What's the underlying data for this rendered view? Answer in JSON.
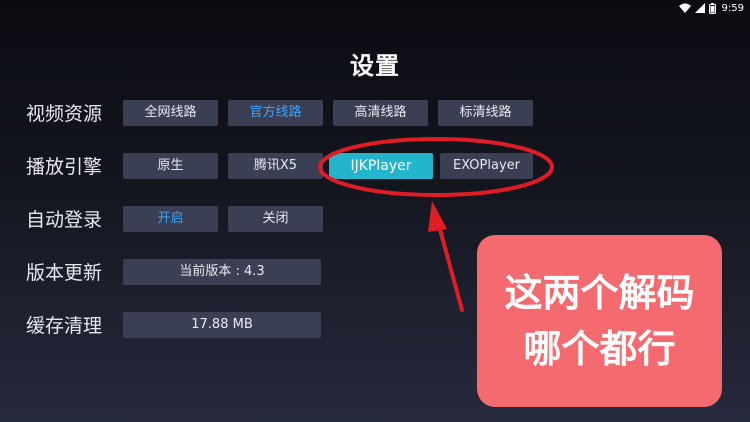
{
  "status_bar": {
    "time": "9:59",
    "icons": [
      "wifi-icon",
      "signal-icon",
      "battery-icon"
    ]
  },
  "title": "设置",
  "settings": {
    "video_source": {
      "label": "视频资源",
      "options": [
        "全网线路",
        "官方线路",
        "高清线路",
        "标清线路"
      ],
      "selected": "官方线路"
    },
    "player_engine": {
      "label": "播放引擎",
      "options": [
        "原生",
        "腾讯X5",
        "IJKPlayer",
        "EXOPlayer"
      ],
      "selected": "IJKPlayer"
    },
    "auto_login": {
      "label": "自动登录",
      "options": [
        "开启",
        "关闭"
      ],
      "selected": "开启"
    },
    "version": {
      "label": "版本更新",
      "value": "当前版本 : 4.3"
    },
    "cache": {
      "label": "缓存清理",
      "value": "17.88 MB"
    }
  },
  "annotation": {
    "line1": "这两个解码",
    "line2": "哪个都行"
  },
  "colors": {
    "active_text": "#3fa3ff",
    "highlight_bg": "#22b5cc",
    "button_bg": "#3a3f53",
    "annotation_red": "#e01c24",
    "callout_bg": "#f46a6e"
  }
}
